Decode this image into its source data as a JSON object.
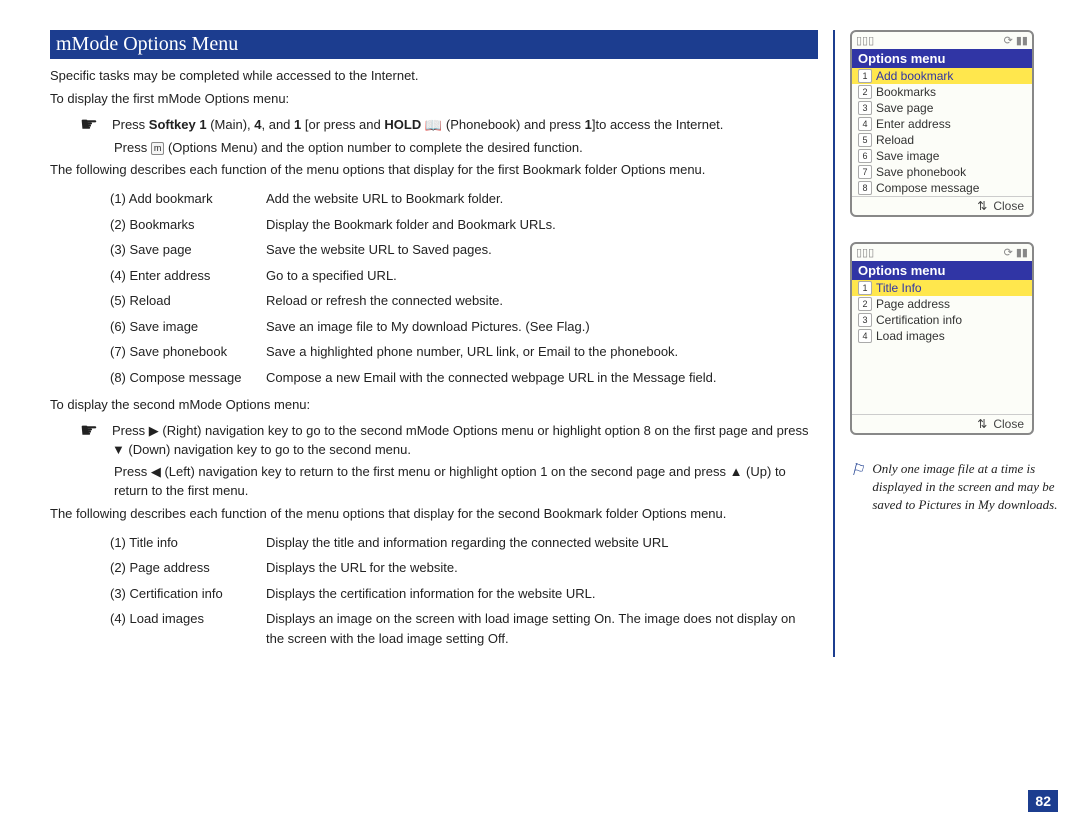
{
  "heading": "mMode Options Menu",
  "intro1": "Specific tasks may be completed while accessed to the Internet.",
  "intro2": "To display the first mMode Options menu:",
  "bullet1": {
    "press": "Press ",
    "softkey1": "Softkey 1",
    "main": " (Main), ",
    "four": "4",
    "and": ", and ",
    "one": "1",
    "middle": " [or press and ",
    "hold": "HOLD",
    "phonebook": " (Phonebook) and press ",
    "one2": "1",
    "end": "]to access the Internet."
  },
  "sub1": "Press       (Options Menu) and the option number to complete the desired function.",
  "desc1": "The following describes each function of the menu options that display for the first Bookmark folder Options menu.",
  "defs1": [
    {
      "k": "(1) Add bookmark",
      "v": "Add the website URL to Bookmark folder."
    },
    {
      "k": "(2) Bookmarks",
      "v": "Display the Bookmark folder and Bookmark URLs."
    },
    {
      "k": "(3) Save page",
      "v": "Save the website URL to Saved pages."
    },
    {
      "k": "(4) Enter address",
      "v": "Go to a specified URL."
    },
    {
      "k": "(5) Reload",
      "v": "Reload or refresh the connected website."
    },
    {
      "k": "(6) Save image",
      "v": "Save an image file to My download Pictures. (See Flag.)"
    },
    {
      "k": "(7) Save phonebook",
      "v": "Save a highlighted phone number, URL link, or Email to the phonebook."
    },
    {
      "k": "(8) Compose message",
      "v": "Compose a new Email with the connected webpage URL in the Message field."
    }
  ],
  "intro3": "To display the second mMode Options menu:",
  "bullet2": "Press ▶ (Right) navigation key to go to the second mMode Options menu or highlight option 8 on the first page and press ▼ (Down) navigation key to go to the second menu.",
  "sub2": "Press ◀ (Left) navigation key to return to the first menu or highlight option 1 on the second page and press ▲ (Up) to return to the first menu.",
  "desc2": "The following describes each function of the menu options that display for the second Bookmark folder Options menu.",
  "defs2": [
    {
      "k": "(1) Title info",
      "v": "Display the title and information regarding the connected website URL"
    },
    {
      "k": "(2) Page address",
      "v": "Displays the URL for the website."
    },
    {
      "k": "(3) Certification info",
      "v": "Displays the certification information for the website URL."
    },
    {
      "k": "(4) Load images",
      "v": "Displays an image on the screen with load image setting On. The image does not display on the   screen with the load image setting Off."
    }
  ],
  "phone1": {
    "title": "Options menu",
    "items": [
      "Add bookmark",
      "Bookmarks",
      "Save page",
      "Enter address",
      "Reload",
      "Save image",
      "Save phonebook",
      "Compose message"
    ],
    "close": "Close"
  },
  "phone2": {
    "title": "Options menu",
    "items": [
      "Title Info",
      "Page address",
      "Certification info",
      "Load images"
    ],
    "close": "Close"
  },
  "note": "Only one image file at a time is displayed in the screen and may be saved to Pictures in My downloads.",
  "pageNumber": "82"
}
